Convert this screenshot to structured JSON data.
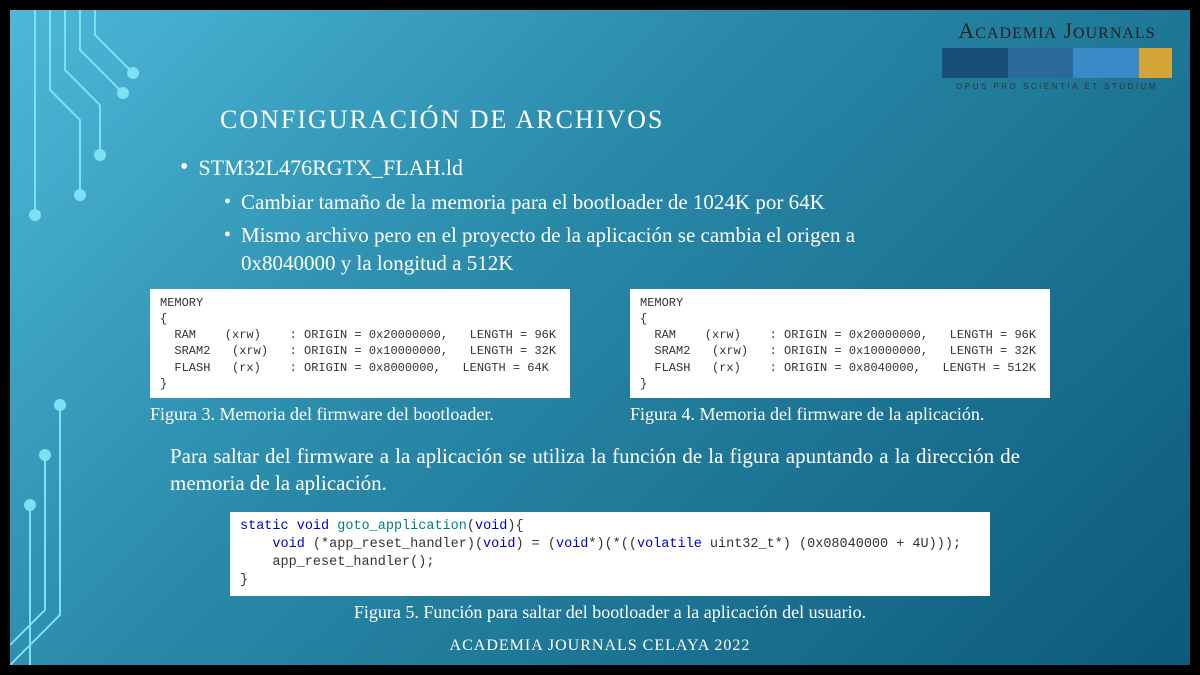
{
  "logo": {
    "main": "ACADEMIA JOURNALS",
    "motto": "OPUS PRO SCIENTIA ET STUDIUM"
  },
  "title": "CONFIGURACIÓN DE ARCHIVOS",
  "bullet_main": "STM32L476RGTX_FLAH.ld",
  "bullet_sub1": "Cambiar tamaño de la memoria para el bootloader de 1024K por 64K",
  "bullet_sub2": "Mismo archivo pero en el proyecto de la aplicación se cambia el origen a 0x8040000 y la longitud a 512K",
  "code_left": "MEMORY\n{\n  RAM    (xrw)    : ORIGIN = 0x20000000,   LENGTH = 96K\n  SRAM2   (xrw)   : ORIGIN = 0x10000000,   LENGTH = 32K\n  FLASH   (rx)    : ORIGIN = 0x8000000,   LENGTH = 64K\n}",
  "caption_left": "Figura 3. Memoria del firmware del bootloader.",
  "code_right": "MEMORY\n{\n  RAM    (xrw)    : ORIGIN = 0x20000000,   LENGTH = 96K\n  SRAM2   (xrw)   : ORIGIN = 0x10000000,   LENGTH = 32K\n  FLASH   (rx)    : ORIGIN = 0x8040000,   LENGTH = 512K\n}",
  "caption_right": "Figura 4. Memoria del firmware de la aplicación.",
  "paragraph": "Para saltar del firmware a la aplicación se utiliza la función de la figura apuntando a la dirección de memoria de la aplicación.",
  "code_bottom_plain": "static void goto_application(void){\n    void (*app_reset_handler)(void) = (void*)(*((volatile uint32_t*) (0x08040000 + 4U)));\n    app_reset_handler();\n}",
  "caption_bottom": "Figura 5. Función para saltar del bootloader a la aplicación del usuario.",
  "footer": "ACADEMIA JOURNALS CELAYA 2022"
}
